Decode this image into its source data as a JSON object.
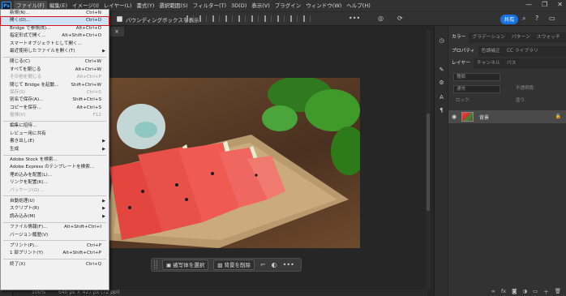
{
  "menubar": {
    "logo": "Ps",
    "items": [
      "ファイル(F)",
      "編集(E)",
      "イメージ(I)",
      "レイヤー(L)",
      "書式(Y)",
      "選択範囲(S)",
      "フィルター(T)",
      "3D(D)",
      "表示(V)",
      "プラグイン",
      "ウィンドウ(W)",
      "ヘルプ(H)"
    ],
    "window_controls": [
      "—",
      "❐",
      "✕"
    ]
  },
  "options": {
    "bounding_box_label": "バウンディングボックスを表示",
    "share_label": "共有"
  },
  "doc": {
    "tab_close": "×",
    "zoom": "100%",
    "info": "640 px × 427 px (72 ppi)"
  },
  "context_bar": {
    "select_subject": "被写体を選択",
    "remove_bg": "背景を削除",
    "more": "•••"
  },
  "file_menu": {
    "items": [
      {
        "label": "新規(N)...",
        "shortcut": "Ctrl+N"
      },
      {
        "label": "開く(O)...",
        "shortcut": "Ctrl+O",
        "highlight": true
      },
      {
        "label": "Bridge で参照(B)...",
        "shortcut": "Alt+Ctrl+O"
      },
      {
        "label": "指定形式で開く...",
        "shortcut": "Alt+Shift+Ctrl+O"
      },
      {
        "label": "スマートオブジェクトとして開く...",
        "shortcut": ""
      },
      {
        "label": "最近使用したファイルを開く(T)",
        "shortcut": "",
        "submenu": true
      },
      {
        "sep": true
      },
      {
        "label": "閉じる(C)",
        "shortcut": "Ctrl+W"
      },
      {
        "label": "すべてを閉じる",
        "shortcut": "Alt+Ctrl+W"
      },
      {
        "label": "その他を閉じる",
        "shortcut": "Alt+Ctrl+P",
        "disabled": true
      },
      {
        "label": "閉じて Bridge を起動...",
        "shortcut": "Shift+Ctrl+W"
      },
      {
        "label": "保存(S)",
        "shortcut": "Ctrl+S",
        "disabled": true
      },
      {
        "label": "別名で保存(A)...",
        "shortcut": "Shift+Ctrl+S"
      },
      {
        "label": "コピーを保存...",
        "shortcut": "Alt+Ctrl+S"
      },
      {
        "label": "復帰(V)",
        "shortcut": "F12",
        "disabled": true
      },
      {
        "sep": true
      },
      {
        "label": "編集に招待...",
        "shortcut": ""
      },
      {
        "label": "レビュー用に共有",
        "shortcut": ""
      },
      {
        "label": "書き出し(E)",
        "shortcut": "",
        "submenu": true
      },
      {
        "label": "生成",
        "shortcut": "",
        "submenu": true
      },
      {
        "sep": true
      },
      {
        "label": "Adobe Stock を検索...",
        "shortcut": ""
      },
      {
        "label": "Adobe Express のテンプレートを検索...",
        "shortcut": ""
      },
      {
        "label": "埋め込みを配置(L)...",
        "shortcut": ""
      },
      {
        "label": "リンクを配置(K)...",
        "shortcut": ""
      },
      {
        "label": "パッケージ(G)...",
        "shortcut": "",
        "disabled": true
      },
      {
        "sep": true
      },
      {
        "label": "自動処理(U)",
        "shortcut": "",
        "submenu": true
      },
      {
        "label": "スクリプト(R)",
        "shortcut": "",
        "submenu": true
      },
      {
        "label": "読み込み(M)",
        "shortcut": "",
        "submenu": true
      },
      {
        "sep": true
      },
      {
        "label": "ファイル情報(F)...",
        "shortcut": "Alt+Shift+Ctrl+I"
      },
      {
        "label": "バージョン履歴(V)",
        "shortcut": ""
      },
      {
        "sep": true
      },
      {
        "label": "プリント(P)...",
        "shortcut": "Ctrl+P"
      },
      {
        "label": "1 部プリント(Y)",
        "shortcut": "Alt+Shift+Ctrl+P"
      },
      {
        "sep": true
      },
      {
        "label": "終了(X)",
        "shortcut": "Ctrl+Q"
      }
    ]
  },
  "panels": {
    "tabs_top": [
      "カラー",
      "グラデーション",
      "パターン",
      "スウォッチ"
    ],
    "tabs_mid": [
      "プロパティ",
      "色調補正",
      "CC ライブラリ"
    ],
    "tabs_layers": [
      "レイヤー",
      "チャンネル",
      "パス"
    ],
    "kind_placeholder": "種類",
    "blend_mode": "通常",
    "opacity_label": "不透明度:",
    "fill_label": "塗り:",
    "lock_label": "ロック:",
    "layer_name": "背景"
  },
  "colors": {
    "accent": "#1473e6",
    "highlight_outline": "#d0121b"
  }
}
